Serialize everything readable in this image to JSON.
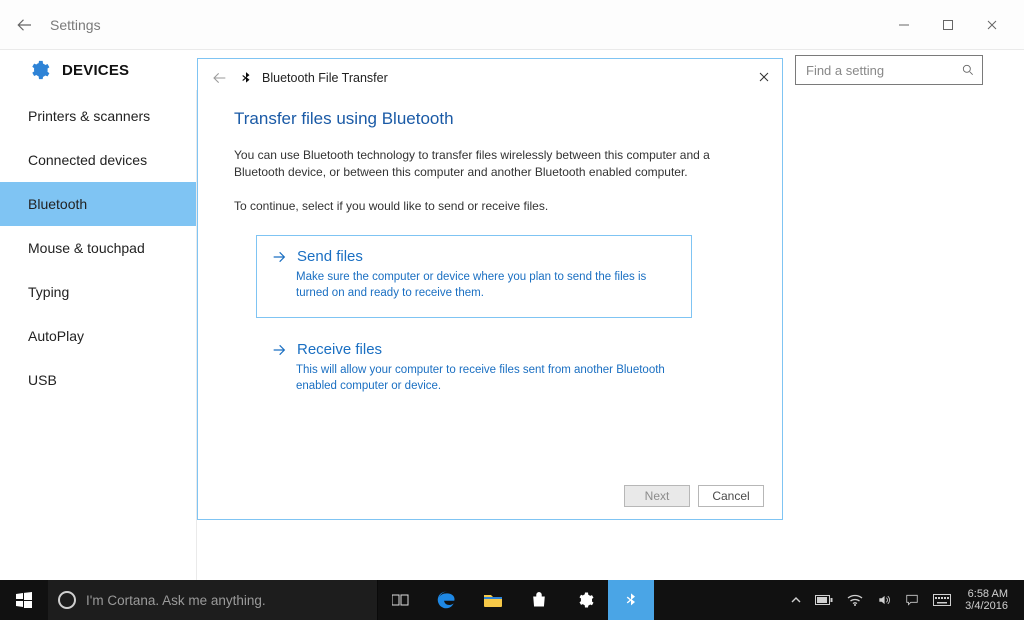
{
  "titlebar": {
    "title": "Settings"
  },
  "header": {
    "section_title": "DEVICES"
  },
  "search": {
    "placeholder": "Find a setting"
  },
  "sidebar": {
    "items": [
      {
        "label": "Printers & scanners",
        "active": false
      },
      {
        "label": "Connected devices",
        "active": false
      },
      {
        "label": "Bluetooth",
        "active": true
      },
      {
        "label": "Mouse & touchpad",
        "active": false
      },
      {
        "label": "Typing",
        "active": false
      },
      {
        "label": "AutoPlay",
        "active": false
      },
      {
        "label": "USB",
        "active": false
      }
    ]
  },
  "dialog": {
    "window_title": "Bluetooth File Transfer",
    "heading": "Transfer files using Bluetooth",
    "intro": "You can use Bluetooth technology to transfer files wirelessly between this computer and a Bluetooth device, or between this computer and another Bluetooth enabled computer.",
    "instruction": "To continue, select if you would like to send or receive files.",
    "options": [
      {
        "title": "Send files",
        "description": "Make sure the computer or device where you plan to send the files is turned on and ready to receive them.",
        "hovered": true
      },
      {
        "title": "Receive files",
        "description": "This will allow your computer to receive files sent from another Bluetooth enabled computer or device.",
        "hovered": false
      }
    ],
    "buttons": {
      "next": "Next",
      "cancel": "Cancel"
    }
  },
  "taskbar": {
    "cortana_placeholder": "I'm Cortana. Ask me anything.",
    "clock": {
      "time": "6:58 AM",
      "date": "3/4/2016"
    }
  }
}
